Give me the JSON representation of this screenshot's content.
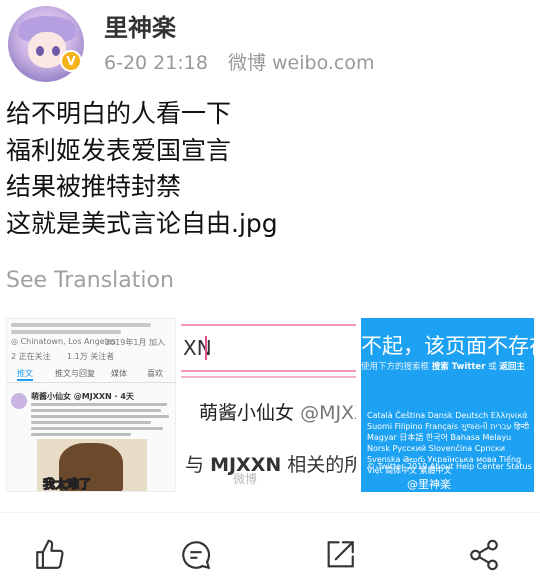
{
  "post": {
    "username": "里神楽",
    "time": "6-20 21:18",
    "source": "微博 weibo.com",
    "verified_badge": "V",
    "lines": [
      "给不明白的人看一下",
      "福利姬发表爱国宣言",
      "结果被推特封禁",
      "这就是美式言论自由.jpg"
    ],
    "see_translation": "See Translation"
  },
  "images": {
    "thumb1": {
      "location": "Chinatown, Los Angeles",
      "joined": "2019年1月 加入",
      "following": "2 正在关注",
      "followers": "1.1万 关注者",
      "tabs": [
        "推文",
        "推文与回复",
        "媒体",
        "喜欢"
      ],
      "tweet_name": "萌酱小仙女 @MJXXN · 4天",
      "meme_caption": "我太难了"
    },
    "thumb2": {
      "search_text": "XN",
      "nickname": "萌酱小仙女",
      "handle": "@MJXXN",
      "related_prefix": "与",
      "related_bold": "MJXXN",
      "related_suffix": "相关的所有",
      "watermark": "微博"
    },
    "thumb3": {
      "error_text": "不起，该页面不存在",
      "sub_text_a": "使用下方的搜索框",
      "sub_text_b": "搜索 Twitter",
      "sub_text_c": "或",
      "sub_text_d": "返回主",
      "languages": "Català  Čeština  Dansk  Deutsch  Ελληνικά  Suomi  Filipino  Français  ગુજરાતી  עברית  हिन्दी  Magyar  日本語  한국어  Bahasa Melayu  Norsk  Русский  Slovenčina  Српски  Svenska  తెలుగు  Українська мова  Tiếng Việt  简体中文  繁體中文",
      "footer": "© Twitter 2019   About   Help Center   Status",
      "watermark": "@里神楽"
    }
  },
  "colors": {
    "twitter_blue": "#1da1f2",
    "meta_gray": "#999999",
    "badge_orange": "#f6b21a",
    "search_pink": "#f09bb4"
  },
  "actions": {
    "like_icon": "thumbs-up-icon",
    "comment_icon": "comment-icon",
    "repost_icon": "repost-icon",
    "share_icon": "share-icon"
  }
}
